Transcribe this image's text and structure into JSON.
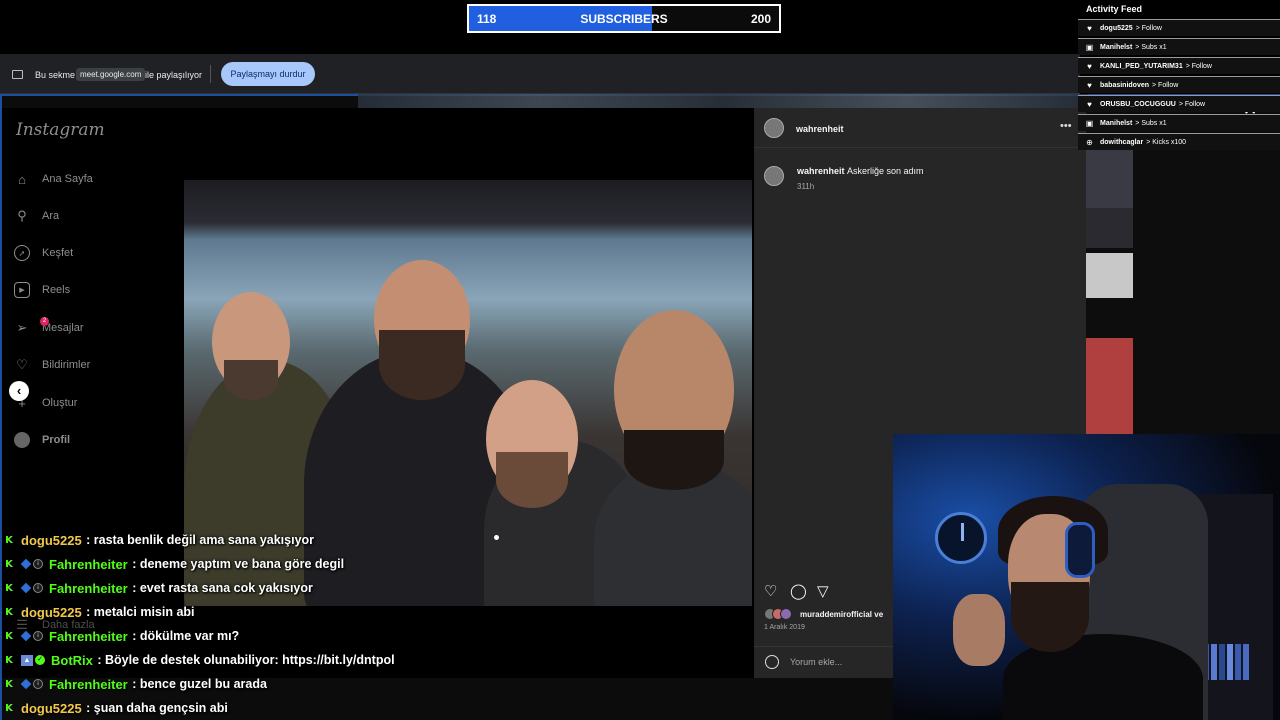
{
  "sub_goal": {
    "current": "118",
    "label": "SUBSCRIBERS",
    "goal": "200",
    "progress_fraction": 0.59,
    "fill_color": "#1f5fe0"
  },
  "share_bar": {
    "prefix": "Bu sekme",
    "domain": "meet.google.com",
    "suffix": "ile paylaşılıyor",
    "stop_button": "Paylaşmayı durdur"
  },
  "instagram": {
    "logo": "Instagram",
    "nav": [
      {
        "label": "Ana Sayfa",
        "icon": "home-icon"
      },
      {
        "label": "Ara",
        "icon": "search-icon"
      },
      {
        "label": "Keşfet",
        "icon": "compass-icon"
      },
      {
        "label": "Reels",
        "icon": "reels-icon"
      },
      {
        "label": "Mesajlar",
        "icon": "messenger-icon",
        "badge": "2"
      },
      {
        "label": "Bildirimler",
        "icon": "heart-icon"
      },
      {
        "label": "Oluştur",
        "icon": "plus-icon"
      },
      {
        "label": "Profil",
        "icon": "avatar-icon"
      }
    ],
    "more_label": "Daha fazla",
    "post": {
      "username": "wahrenheit",
      "caption_user": "wahrenheit",
      "caption": "Askerliğe son adım",
      "caption_time": "311h",
      "likes_text": "muraddemirofficial ve",
      "date": "1 Aralık 2019",
      "comment_placeholder": "Yorum ekle..."
    }
  },
  "activity_feed": {
    "title": "Activity Feed",
    "items": [
      {
        "icon": "heart-icon",
        "user": "dogu5225",
        "action": "> Follow"
      },
      {
        "icon": "gift-icon",
        "user": "Manihelst",
        "action": "> Subs x1"
      },
      {
        "icon": "heart-icon",
        "user": "KANLI_PED_YUTARIM31",
        "action": "> Follow"
      },
      {
        "icon": "heart-icon",
        "user": "babasinidoven",
        "action": "> Follow"
      },
      {
        "icon": "heart-icon",
        "user": "ORUSBU_COCUGGUU",
        "action": "> Follow"
      },
      {
        "icon": "gift-icon",
        "user": "Manihelst",
        "action": "> Subs x1"
      },
      {
        "icon": "kick-icon",
        "user": "dowithcaglar",
        "action": "> Kicks x100"
      }
    ]
  },
  "chat": [
    {
      "user": "dogu5225",
      "color": "#f2c84b",
      "badges": [],
      "message": ": rasta benlik değil ama sana yakışıyor"
    },
    {
      "user": "Fahrenheiter",
      "color": "#53fc18",
      "badges": [
        "sub",
        "verified"
      ],
      "message": ": deneme yaptım ve bana göre degil"
    },
    {
      "user": "Fahrenheiter",
      "color": "#53fc18",
      "badges": [
        "sub",
        "verified"
      ],
      "message": ": evet rasta sana cok yakısıyor"
    },
    {
      "user": "dogu5225",
      "color": "#f2c84b",
      "badges": [],
      "message": ": metalci misin abi"
    },
    {
      "user": "Fahrenheiter",
      "color": "#53fc18",
      "badges": [
        "sub",
        "verified"
      ],
      "message": ": dökülme var mı?"
    },
    {
      "user": "BotRix",
      "color": "#53fc18",
      "badges": [
        "bot",
        "check"
      ],
      "message": ": Böyle de destek olunabiliyor: https://bit.ly/dntpol"
    },
    {
      "user": "Fahrenheiter",
      "color": "#53fc18",
      "badges": [
        "sub",
        "verified"
      ],
      "message": ": bence guzel bu arada"
    },
    {
      "user": "dogu5225",
      "color": "#f2c84b",
      "badges": [],
      "message": ": şuan daha gençsin abi"
    }
  ]
}
